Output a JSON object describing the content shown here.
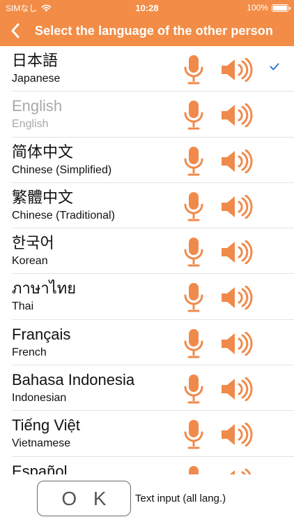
{
  "status_bar": {
    "carrier": "SIMなし",
    "time": "10:28",
    "battery": "100%"
  },
  "header": {
    "title": "Select the language of the other person"
  },
  "languages": [
    {
      "native": "日本語",
      "english": "Japanese",
      "selected": true,
      "dim": false
    },
    {
      "native": "English",
      "english": "English",
      "selected": false,
      "dim": true
    },
    {
      "native": "简体中文",
      "english": "Chinese (Simplified)",
      "selected": false,
      "dim": false
    },
    {
      "native": "繁體中文",
      "english": "Chinese (Traditional)",
      "selected": false,
      "dim": false
    },
    {
      "native": "한국어",
      "english": "Korean",
      "selected": false,
      "dim": false
    },
    {
      "native": "ภาษาไทย",
      "english": "Thai",
      "selected": false,
      "dim": false
    },
    {
      "native": "Français",
      "english": "French",
      "selected": false,
      "dim": false
    },
    {
      "native": "Bahasa Indonesia",
      "english": "Indonesian",
      "selected": false,
      "dim": false
    },
    {
      "native": "Tiếng Việt",
      "english": "Vietnamese",
      "selected": false,
      "dim": false
    },
    {
      "native": "Español",
      "english": "",
      "selected": false,
      "dim": false
    }
  ],
  "footer": {
    "ok_label": "O K",
    "text_input_label": "Text input (all lang.)"
  },
  "colors": {
    "accent": "#f28c46",
    "icon": "#f08a4b",
    "check": "#2f7ad8",
    "dim_text": "#a8a8a8"
  },
  "icons": {
    "mic": "microphone-icon",
    "speaker": "speaker-icon",
    "check": "checkmark-icon",
    "back": "chevron-left-icon"
  }
}
